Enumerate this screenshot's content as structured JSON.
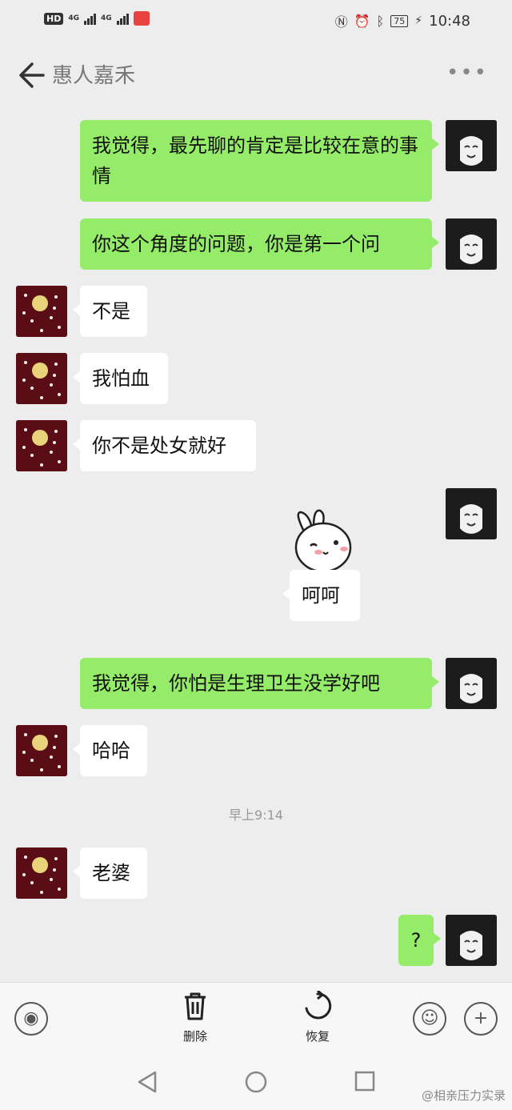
{
  "status_bar": {
    "hd": "HD",
    "net1": "4G",
    "net2": "4G",
    "battery": "75",
    "time": "10:48"
  },
  "header": {
    "title": "惠人嘉禾"
  },
  "messages": [
    {
      "from": "me",
      "text": "我觉得，最先聊的肯定是比较在意的事情"
    },
    {
      "from": "me",
      "text": "你这个角度的问题，你是第一个问"
    },
    {
      "from": "other",
      "text": "不是"
    },
    {
      "from": "other",
      "text": "我怕血"
    },
    {
      "from": "other",
      "text": "你不是处女就好"
    },
    {
      "from": "me",
      "sticker_caption": "呵呵"
    },
    {
      "from": "me",
      "text": "我觉得，你怕是生理卫生没学好吧"
    },
    {
      "from": "other",
      "text": "哈哈"
    },
    {
      "from": "other",
      "text": "老婆"
    },
    {
      "from": "me",
      "text": "?"
    }
  ],
  "timestamp": "早上9:14",
  "bottom_bar": {
    "delete_label": "删除",
    "restore_label": "恢复"
  },
  "watermark": "@相亲压力实录",
  "colors": {
    "my_bubble": "#95ec69",
    "their_bubble": "#ffffff",
    "background": "#ededed"
  }
}
